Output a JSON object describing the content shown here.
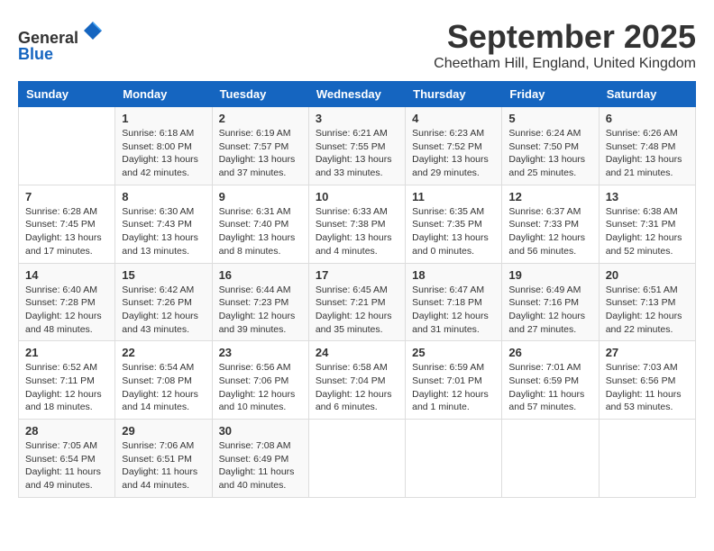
{
  "logo": {
    "general": "General",
    "blue": "Blue"
  },
  "header": {
    "month": "September 2025",
    "location": "Cheetham Hill, England, United Kingdom"
  },
  "weekdays": [
    "Sunday",
    "Monday",
    "Tuesday",
    "Wednesday",
    "Thursday",
    "Friday",
    "Saturday"
  ],
  "weeks": [
    [
      {
        "day": "",
        "sunrise": "",
        "sunset": "",
        "daylight": ""
      },
      {
        "day": "1",
        "sunrise": "Sunrise: 6:18 AM",
        "sunset": "Sunset: 8:00 PM",
        "daylight": "Daylight: 13 hours and 42 minutes."
      },
      {
        "day": "2",
        "sunrise": "Sunrise: 6:19 AM",
        "sunset": "Sunset: 7:57 PM",
        "daylight": "Daylight: 13 hours and 37 minutes."
      },
      {
        "day": "3",
        "sunrise": "Sunrise: 6:21 AM",
        "sunset": "Sunset: 7:55 PM",
        "daylight": "Daylight: 13 hours and 33 minutes."
      },
      {
        "day": "4",
        "sunrise": "Sunrise: 6:23 AM",
        "sunset": "Sunset: 7:52 PM",
        "daylight": "Daylight: 13 hours and 29 minutes."
      },
      {
        "day": "5",
        "sunrise": "Sunrise: 6:24 AM",
        "sunset": "Sunset: 7:50 PM",
        "daylight": "Daylight: 13 hours and 25 minutes."
      },
      {
        "day": "6",
        "sunrise": "Sunrise: 6:26 AM",
        "sunset": "Sunset: 7:48 PM",
        "daylight": "Daylight: 13 hours and 21 minutes."
      }
    ],
    [
      {
        "day": "7",
        "sunrise": "Sunrise: 6:28 AM",
        "sunset": "Sunset: 7:45 PM",
        "daylight": "Daylight: 13 hours and 17 minutes."
      },
      {
        "day": "8",
        "sunrise": "Sunrise: 6:30 AM",
        "sunset": "Sunset: 7:43 PM",
        "daylight": "Daylight: 13 hours and 13 minutes."
      },
      {
        "day": "9",
        "sunrise": "Sunrise: 6:31 AM",
        "sunset": "Sunset: 7:40 PM",
        "daylight": "Daylight: 13 hours and 8 minutes."
      },
      {
        "day": "10",
        "sunrise": "Sunrise: 6:33 AM",
        "sunset": "Sunset: 7:38 PM",
        "daylight": "Daylight: 13 hours and 4 minutes."
      },
      {
        "day": "11",
        "sunrise": "Sunrise: 6:35 AM",
        "sunset": "Sunset: 7:35 PM",
        "daylight": "Daylight: 13 hours and 0 minutes."
      },
      {
        "day": "12",
        "sunrise": "Sunrise: 6:37 AM",
        "sunset": "Sunset: 7:33 PM",
        "daylight": "Daylight: 12 hours and 56 minutes."
      },
      {
        "day": "13",
        "sunrise": "Sunrise: 6:38 AM",
        "sunset": "Sunset: 7:31 PM",
        "daylight": "Daylight: 12 hours and 52 minutes."
      }
    ],
    [
      {
        "day": "14",
        "sunrise": "Sunrise: 6:40 AM",
        "sunset": "Sunset: 7:28 PM",
        "daylight": "Daylight: 12 hours and 48 minutes."
      },
      {
        "day": "15",
        "sunrise": "Sunrise: 6:42 AM",
        "sunset": "Sunset: 7:26 PM",
        "daylight": "Daylight: 12 hours and 43 minutes."
      },
      {
        "day": "16",
        "sunrise": "Sunrise: 6:44 AM",
        "sunset": "Sunset: 7:23 PM",
        "daylight": "Daylight: 12 hours and 39 minutes."
      },
      {
        "day": "17",
        "sunrise": "Sunrise: 6:45 AM",
        "sunset": "Sunset: 7:21 PM",
        "daylight": "Daylight: 12 hours and 35 minutes."
      },
      {
        "day": "18",
        "sunrise": "Sunrise: 6:47 AM",
        "sunset": "Sunset: 7:18 PM",
        "daylight": "Daylight: 12 hours and 31 minutes."
      },
      {
        "day": "19",
        "sunrise": "Sunrise: 6:49 AM",
        "sunset": "Sunset: 7:16 PM",
        "daylight": "Daylight: 12 hours and 27 minutes."
      },
      {
        "day": "20",
        "sunrise": "Sunrise: 6:51 AM",
        "sunset": "Sunset: 7:13 PM",
        "daylight": "Daylight: 12 hours and 22 minutes."
      }
    ],
    [
      {
        "day": "21",
        "sunrise": "Sunrise: 6:52 AM",
        "sunset": "Sunset: 7:11 PM",
        "daylight": "Daylight: 12 hours and 18 minutes."
      },
      {
        "day": "22",
        "sunrise": "Sunrise: 6:54 AM",
        "sunset": "Sunset: 7:08 PM",
        "daylight": "Daylight: 12 hours and 14 minutes."
      },
      {
        "day": "23",
        "sunrise": "Sunrise: 6:56 AM",
        "sunset": "Sunset: 7:06 PM",
        "daylight": "Daylight: 12 hours and 10 minutes."
      },
      {
        "day": "24",
        "sunrise": "Sunrise: 6:58 AM",
        "sunset": "Sunset: 7:04 PM",
        "daylight": "Daylight: 12 hours and 6 minutes."
      },
      {
        "day": "25",
        "sunrise": "Sunrise: 6:59 AM",
        "sunset": "Sunset: 7:01 PM",
        "daylight": "Daylight: 12 hours and 1 minute."
      },
      {
        "day": "26",
        "sunrise": "Sunrise: 7:01 AM",
        "sunset": "Sunset: 6:59 PM",
        "daylight": "Daylight: 11 hours and 57 minutes."
      },
      {
        "day": "27",
        "sunrise": "Sunrise: 7:03 AM",
        "sunset": "Sunset: 6:56 PM",
        "daylight": "Daylight: 11 hours and 53 minutes."
      }
    ],
    [
      {
        "day": "28",
        "sunrise": "Sunrise: 7:05 AM",
        "sunset": "Sunset: 6:54 PM",
        "daylight": "Daylight: 11 hours and 49 minutes."
      },
      {
        "day": "29",
        "sunrise": "Sunrise: 7:06 AM",
        "sunset": "Sunset: 6:51 PM",
        "daylight": "Daylight: 11 hours and 44 minutes."
      },
      {
        "day": "30",
        "sunrise": "Sunrise: 7:08 AM",
        "sunset": "Sunset: 6:49 PM",
        "daylight": "Daylight: 11 hours and 40 minutes."
      },
      {
        "day": "",
        "sunrise": "",
        "sunset": "",
        "daylight": ""
      },
      {
        "day": "",
        "sunrise": "",
        "sunset": "",
        "daylight": ""
      },
      {
        "day": "",
        "sunrise": "",
        "sunset": "",
        "daylight": ""
      },
      {
        "day": "",
        "sunrise": "",
        "sunset": "",
        "daylight": ""
      }
    ]
  ]
}
